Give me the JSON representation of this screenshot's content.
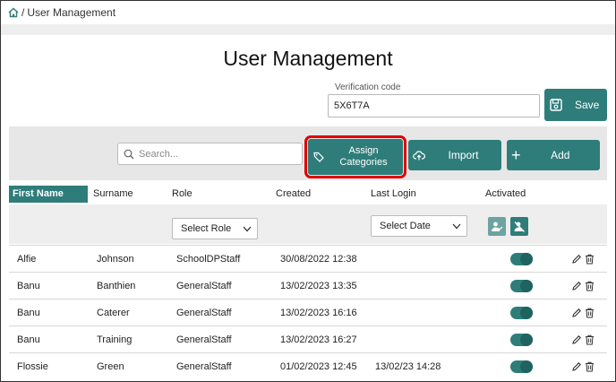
{
  "breadcrumb": {
    "separator": "/",
    "current": "User Management"
  },
  "page": {
    "title": "User Management"
  },
  "verification": {
    "label": "Verification code",
    "value": "5X6T7A"
  },
  "buttons": {
    "save": "Save",
    "assign_line1": "Assign",
    "assign_line2": "Categories",
    "import": "Import",
    "add": "Add"
  },
  "search": {
    "placeholder": "Search..."
  },
  "columns": {
    "first_name": "First Name",
    "surname": "Surname",
    "role": "Role",
    "created": "Created",
    "last_login": "Last Login",
    "activated": "Activated"
  },
  "filters": {
    "role": "Select Role",
    "date": "Select Date"
  },
  "icons": {
    "home": "home-icon",
    "save": "floppy-disk-icon",
    "search": "magnifier-icon",
    "tag": "tag-icon",
    "import": "cloud-upload-icon",
    "add": "plus-icon",
    "edit": "pencil-icon",
    "delete": "trash-icon",
    "activated_filter": "user-check-icon",
    "deactivated_filter": "user-cross-icon"
  },
  "colors": {
    "accent": "#2e7d7a",
    "highlight": "#e00000"
  },
  "rows": [
    {
      "first_name": "Alfie",
      "surname": "Johnson",
      "role": "SchoolDPStaff",
      "created": "30/08/2022 12:38",
      "last_login": "",
      "activated": true
    },
    {
      "first_name": "Banu",
      "surname": "Banthien",
      "role": "GeneralStaff",
      "created": "13/02/2023 13:35",
      "last_login": "",
      "activated": true
    },
    {
      "first_name": "Banu",
      "surname": "Caterer",
      "role": "GeneralStaff",
      "created": "13/02/2023 16:16",
      "last_login": "",
      "activated": true
    },
    {
      "first_name": "Banu",
      "surname": "Training",
      "role": "GeneralStaff",
      "created": "13/02/2023 16:27",
      "last_login": "",
      "activated": true
    },
    {
      "first_name": "Flossie",
      "surname": "Green",
      "role": "GeneralStaff",
      "created": "01/02/2023 12:45",
      "last_login": "13/02/23 14:28",
      "activated": true
    }
  ]
}
